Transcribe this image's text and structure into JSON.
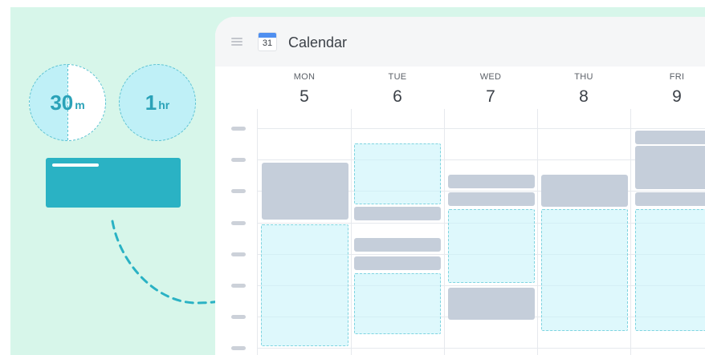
{
  "chips": [
    {
      "num": "30",
      "unit": "m"
    },
    {
      "num": "1",
      "unit": "hr"
    }
  ],
  "calendar": {
    "title": "Calendar",
    "icon_day": "31",
    "days": [
      {
        "name": "MON",
        "date": "5"
      },
      {
        "name": "TUE",
        "date": "6"
      },
      {
        "name": "WED",
        "date": "7"
      },
      {
        "name": "THU",
        "date": "8"
      },
      {
        "name": "FRI",
        "date": "9"
      }
    ]
  },
  "colors": {
    "background_mint": "#d7f6ea",
    "accent_teal": "#2ab2c4",
    "event_gray": "#c5ceda",
    "slot_cyan": "#c8f4fa"
  },
  "icons": [
    "menu-icon",
    "calendar-icon"
  ]
}
